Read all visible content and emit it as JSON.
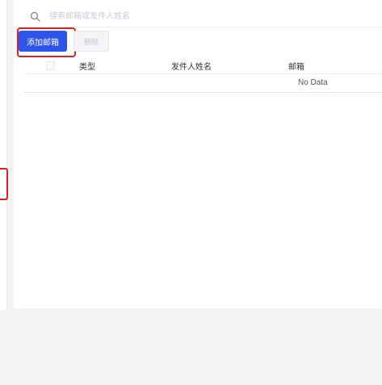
{
  "search": {
    "placeholder": "搜索邮箱或发件人姓名",
    "icon": "search-icon"
  },
  "toolbar": {
    "add_label": "添加邮箱",
    "delete_label": "删除"
  },
  "table": {
    "columns": [
      "类型",
      "发件人姓名",
      "邮箱"
    ],
    "empty_text": "No Data"
  },
  "colors": {
    "primary": "#2f54eb",
    "highlight": "#e02020",
    "background": "#f2f3f5"
  }
}
